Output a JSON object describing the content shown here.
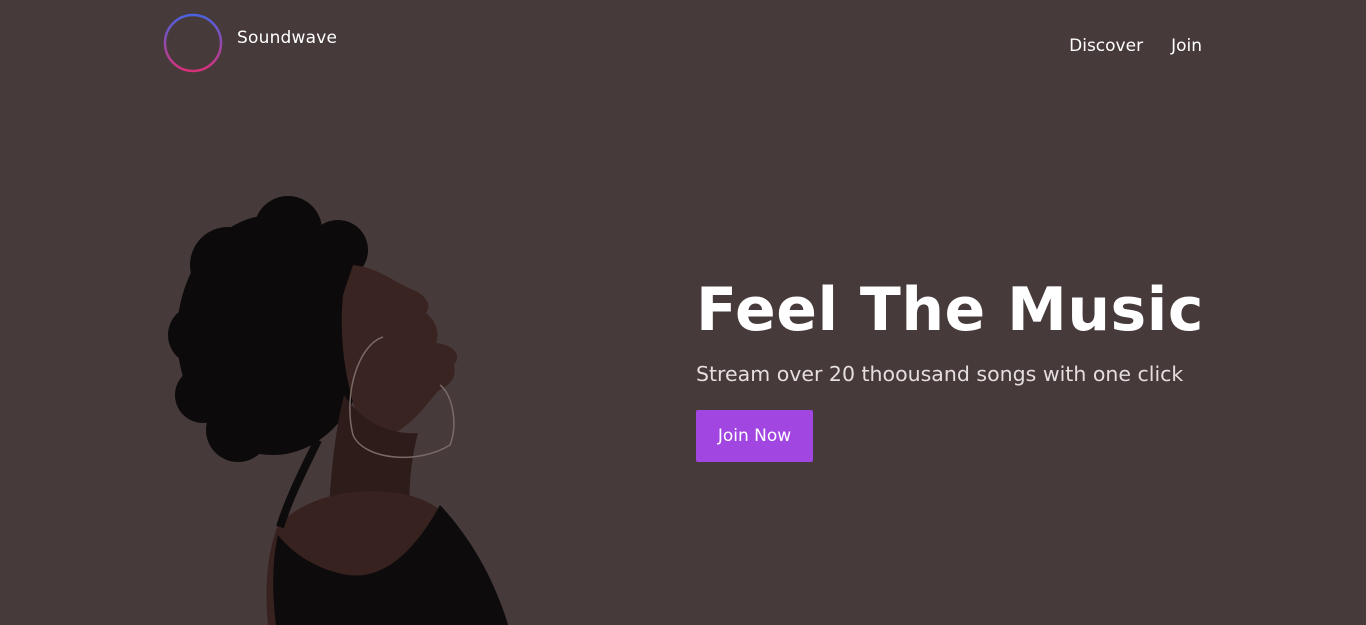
{
  "brand": {
    "name": "Soundwave",
    "logo_icon": "soundwave-circle-logo-icon",
    "logo_gradient": [
      "#4a63e0",
      "#d8307a"
    ]
  },
  "nav": {
    "items": [
      {
        "label": "Discover"
      },
      {
        "label": "Join"
      }
    ]
  },
  "hero": {
    "title": "Feel The Music",
    "subtitle": "Stream over 20 thoousand songs with one click",
    "cta_label": "Join Now",
    "image_icon": "woman-profile-photo"
  },
  "colors": {
    "background": "#473a3b",
    "accent": "#a146e0",
    "text": "#ffffff"
  }
}
